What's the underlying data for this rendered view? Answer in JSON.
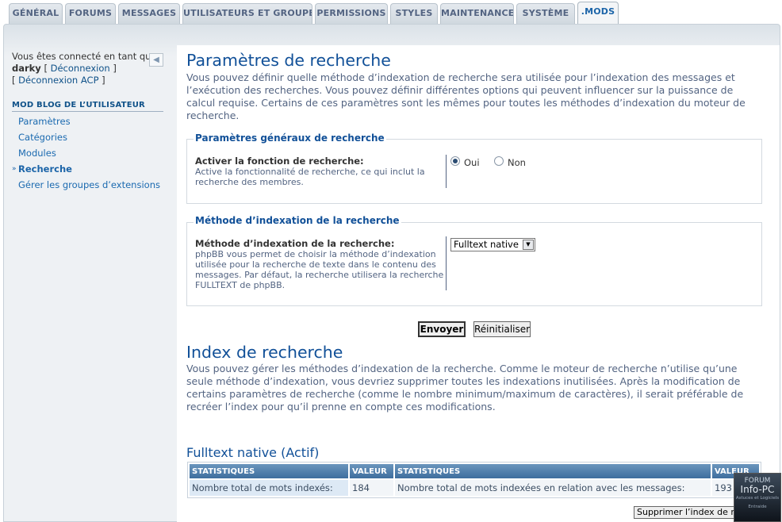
{
  "tabs": [
    {
      "label": "GÉNÉRAL"
    },
    {
      "label": "FORUMS"
    },
    {
      "label": "MESSAGES"
    },
    {
      "label": "UTILISATEURS ET GROUPES"
    },
    {
      "label": "PERMISSIONS"
    },
    {
      "label": "STYLES"
    },
    {
      "label": "MAINTENANCE"
    },
    {
      "label": "SYSTÈME"
    },
    {
      "label": ".MODS"
    }
  ],
  "active_tab": ".MODS",
  "sidebar": {
    "connected_text": "Vous êtes connecté en tant que",
    "username": "darky",
    "logout_label": "Déconnexion",
    "logout_acp_label": "Déconnexion ACP",
    "section_title": "MOD BLOG DE L’UTILISATEUR",
    "items": [
      {
        "label": "Paramètres"
      },
      {
        "label": "Catégories"
      },
      {
        "label": "Modules"
      },
      {
        "label": "Recherche",
        "active": true
      },
      {
        "label": "Gérer les groupes d’extensions"
      }
    ]
  },
  "search_settings": {
    "title": "Paramètres de recherche",
    "description": "Vous pouvez définir quelle méthode d’indexation de recherche sera utilisée pour l’indexation des messages et l’exécution des recherches. Vous pouvez définir différentes options qui peuvent influencer sur la puissance de calcul requise. Certains de ces paramètres sont les mêmes pour toutes les méthodes d’indexation du moteur de recherche.",
    "general": {
      "legend": "Paramètres généraux de recherche",
      "label": "Activer la fonction de recherche:",
      "explain": "Active la fonctionnalité de recherche, ce qui inclut la recherche des membres.",
      "options": [
        {
          "label": "Oui",
          "checked": true
        },
        {
          "label": "Non",
          "checked": false
        }
      ]
    },
    "method": {
      "legend": "Méthode d’indexation de la recherche",
      "label": "Méthode d’indexation de la recherche:",
      "explain": "phpBB vous permet de choisir la méthode d’indexation utilisée pour la recherche de texte dans le contenu des messages. Par défaut, la recherche utilisera la recherche FULLTEXT de phpBB.",
      "selected": "Fulltext native"
    },
    "submit_label": "Envoyer",
    "reset_label": "Réinitialiser"
  },
  "search_index": {
    "title": "Index de recherche",
    "description": "Vous pouvez gérer les méthodes d’indexation de la recherche. Comme le moteur de recherche n’utilise qu’une seule méthode d’indexation, vous devriez supprimer toutes les indexations inutilisées. Après la modification de certains paramètres de recherche (comme le nombre minimum/maximum de caractères), il serait préférable de recréer l’index pour qu’il prenne en compte ces modifications.",
    "backend_title": "Fulltext native (Actif)",
    "columns": [
      "STATISTIQUES",
      "VALEUR",
      "STATISTIQUES",
      "VALEUR"
    ],
    "rows": [
      [
        "Nombre total de mots indexés:",
        "184",
        "Nombre total de mots indexées en relation avec les messages:",
        "193"
      ]
    ],
    "delete_label": "Supprimer l’index de recherche"
  },
  "watermark": {
    "line1": "FORUM",
    "line2": "Info-PC",
    "line3": "Astuces et Logiciels Entraide"
  }
}
